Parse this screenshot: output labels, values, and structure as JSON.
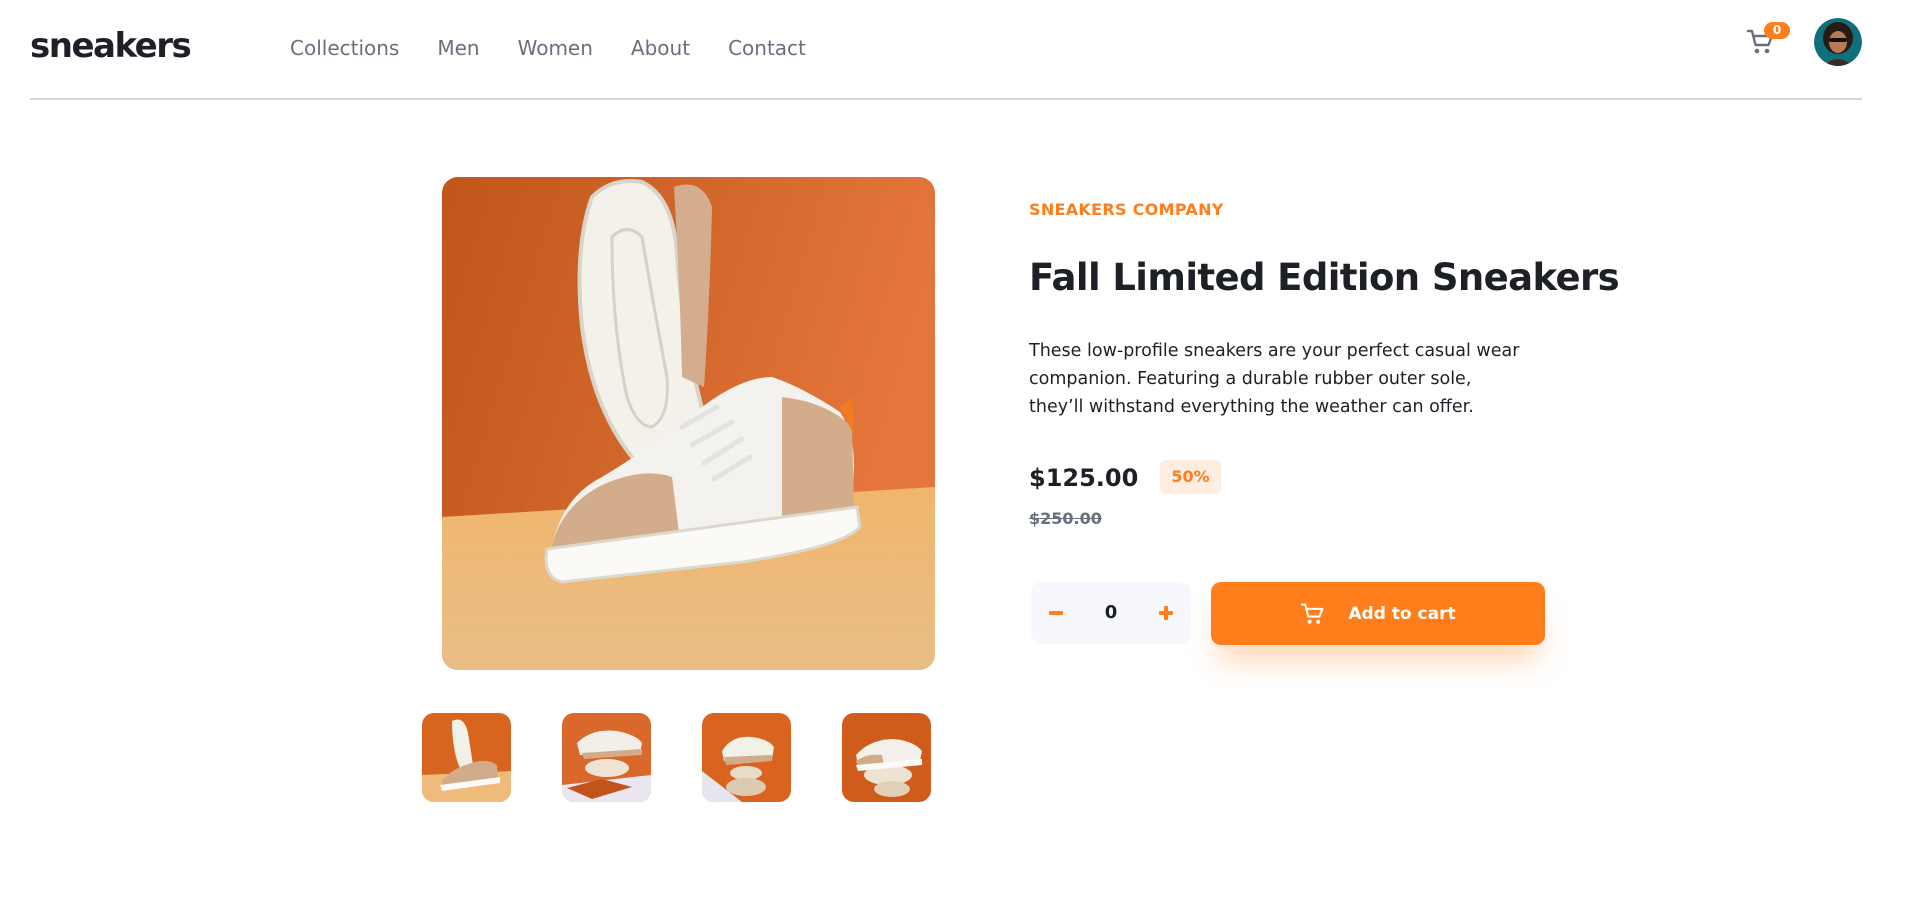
{
  "header": {
    "logo": "sneakers",
    "nav": [
      "Collections",
      "Men",
      "Women",
      "About",
      "Contact"
    ],
    "cart_icon": "cart-icon",
    "cart_count": "0",
    "avatar": "user-avatar"
  },
  "product": {
    "company": "SNEAKERS COMPANY",
    "title": "Fall Limited Edition Sneakers",
    "description": "These low-profile sneakers are your perfect casual wear companion. Featuring a durable rubber outer sole, they’ll withstand everything the weather can offer.",
    "price": "$125.00",
    "discount": "50%",
    "old_price": "$250.00",
    "quantity": "0",
    "add_to_cart_label": "Add to cart",
    "thumbnail_count": 4
  },
  "colors": {
    "accent": "#ff7e1b",
    "accent_pale": "#ffede0",
    "text_dark": "#1d2026",
    "text_gray": "#69707d"
  }
}
